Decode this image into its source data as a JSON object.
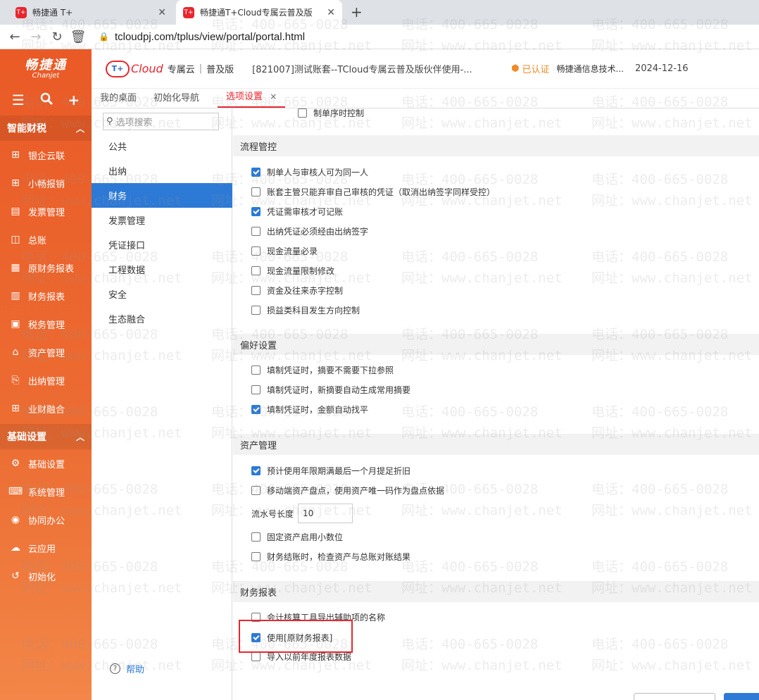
{
  "browser": {
    "tabs": [
      {
        "favicon": "T+",
        "title": "畅捷通 T+"
      },
      {
        "favicon": "T+",
        "title": "畅捷通T+Cloud专属云普及版"
      }
    ],
    "url": "tcloudpj.com/tplus/view/portal/portal.html"
  },
  "sidebar": {
    "logo_cn": "畅捷通",
    "logo_en": "Chanjet",
    "sections": [
      {
        "title": "智能财税",
        "items": [
          {
            "label": "银企云联",
            "icon": "network-icon"
          },
          {
            "label": "小畅报销",
            "icon": "network-icon"
          },
          {
            "label": "发票管理",
            "icon": "invoice-icon"
          },
          {
            "label": "总账",
            "icon": "ledger-icon"
          },
          {
            "label": "原财务报表",
            "icon": "ufo-report-icon"
          },
          {
            "label": "财务报表",
            "icon": "report-icon"
          },
          {
            "label": "税务管理",
            "icon": "tax-icon"
          },
          {
            "label": "资产管理",
            "icon": "bank-icon"
          },
          {
            "label": "出纳管理",
            "icon": "cashier-icon"
          },
          {
            "label": "业财融合",
            "icon": "network-icon"
          }
        ]
      },
      {
        "title": "基础设置",
        "items": [
          {
            "label": "基础设置",
            "icon": "settings-icon"
          },
          {
            "label": "系统管理",
            "icon": "code-icon"
          },
          {
            "label": "协同办公",
            "icon": "collab-icon"
          },
          {
            "label": "云应用",
            "icon": "cloud-icon"
          },
          {
            "label": "初始化",
            "icon": "init-icon"
          }
        ]
      }
    ]
  },
  "header": {
    "brand_tplus": "T+",
    "brand_cloud": "Cloud",
    "brand_zsy": "专属云",
    "brand_sep": "|",
    "brand_edition": "普及版",
    "account": "[821007]测试账套--TCloud专属云普及版伙伴使用-...",
    "verified": "已认证",
    "company": "畅捷通信息技术...",
    "date": "2024-12-16"
  },
  "page_tabs": [
    {
      "label": "我的桌面"
    },
    {
      "label": "初始化导航"
    },
    {
      "label": "选项设置",
      "close": "×"
    }
  ],
  "categories": {
    "search_placeholder": "选项搜索",
    "items": [
      "公共",
      "出纳",
      "财务",
      "发票管理",
      "凭证接口",
      "工程数据",
      "安全",
      "生态融合"
    ],
    "selected": "财务",
    "help": "帮助"
  },
  "options": {
    "top_partial": {
      "label": "制单序时控制",
      "checked": false
    },
    "sections": [
      {
        "title": "流程管控",
        "items": [
          {
            "label": "制单人与审核人可为同一人",
            "checked": true
          },
          {
            "label": "账套主管只能弃审自己审核的凭证（取消出纳签字同样受控）",
            "checked": false
          },
          {
            "label": "凭证需审核才可记账",
            "checked": true
          },
          {
            "label": "出纳凭证必须经由出纳签字",
            "checked": false
          },
          {
            "label": "现金流量必录",
            "checked": false
          },
          {
            "label": "现金流量限制修改",
            "checked": false
          },
          {
            "label": "资金及往来赤字控制",
            "checked": false
          },
          {
            "label": "损益类科目发生方向控制",
            "checked": false
          }
        ]
      },
      {
        "title": "偏好设置",
        "items": [
          {
            "label": "填制凭证时，摘要不需要下拉参照",
            "checked": false
          },
          {
            "label": "填制凭证时，新摘要自动生成常用摘要",
            "checked": false
          },
          {
            "label": "填制凭证时，金额自动找平",
            "checked": true
          }
        ]
      },
      {
        "title": "资产管理",
        "items": [
          {
            "label": "预计使用年限期满最后一个月提足折旧",
            "checked": true
          },
          {
            "label": "移动端资产盘点，使用资产唯一码作为盘点依据",
            "checked": false
          }
        ],
        "serial_label": "流水号长度",
        "serial_value": "10",
        "items_after": [
          {
            "label": "固定资产启用小数位",
            "checked": false
          },
          {
            "label": "财务结账时，检查资产与总账对账结果",
            "checked": false
          }
        ]
      },
      {
        "title": "财务报表",
        "items": [
          {
            "label": "会计核算工具导出辅助项的名称",
            "checked": false
          },
          {
            "label": "使用[原财务报表]",
            "checked": true
          },
          {
            "label": "导入以前年度报表数据",
            "checked": false
          }
        ]
      }
    ]
  },
  "watermark": {
    "phone": "电话：400-665-0028",
    "site": "网址：www.chanjet.net"
  },
  "colors": {
    "accent": "#e8262e",
    "sidebar": "#ec6d33",
    "selected": "#2d7ad6"
  }
}
